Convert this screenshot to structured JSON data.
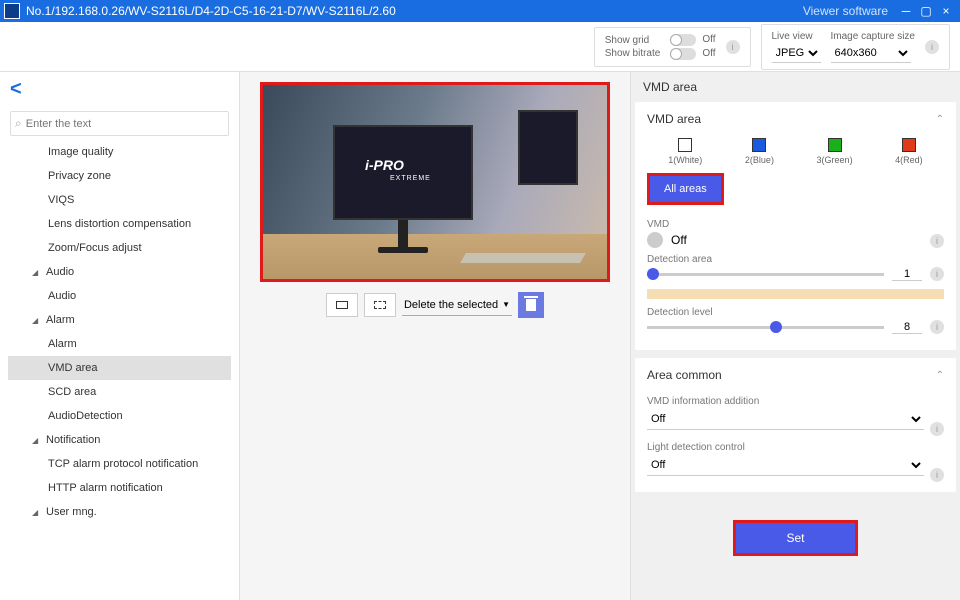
{
  "titlebar": {
    "title": "No.1/192.168.0.26/WV-S2116L/D4-2D-C5-16-21-D7/WV-S2116L/2.60",
    "brand": "Viewer software"
  },
  "topbar": {
    "show_grid_label": "Show grid",
    "show_grid_value": "Off",
    "show_bitrate_label": "Show bitrate",
    "show_bitrate_value": "Off",
    "live_view_label": "Live view",
    "live_view_value": "JPEG",
    "capture_label": "Image capture size",
    "capture_value": "640x360"
  },
  "search": {
    "placeholder": "Enter the text"
  },
  "tree": {
    "items": [
      {
        "label": "Image quality",
        "type": "item"
      },
      {
        "label": "Privacy zone",
        "type": "item"
      },
      {
        "label": "VIQS",
        "type": "item"
      },
      {
        "label": "Lens distortion compensation",
        "type": "item"
      },
      {
        "label": "Zoom/Focus adjust",
        "type": "item"
      },
      {
        "label": "Audio",
        "type": "group"
      },
      {
        "label": "Audio",
        "type": "item"
      },
      {
        "label": "Alarm",
        "type": "group"
      },
      {
        "label": "Alarm",
        "type": "item"
      },
      {
        "label": "VMD area",
        "type": "item",
        "selected": true
      },
      {
        "label": "SCD area",
        "type": "item"
      },
      {
        "label": "AudioDetection",
        "type": "item"
      },
      {
        "label": "Notification",
        "type": "group"
      },
      {
        "label": "TCP alarm protocol notification",
        "type": "item"
      },
      {
        "label": "HTTP alarm notification",
        "type": "item"
      },
      {
        "label": "User mng.",
        "type": "group"
      }
    ]
  },
  "video": {
    "logo": "i-PRO",
    "logo_sub": "EXTREME"
  },
  "video_toolbar": {
    "delete_label": "Delete the selected"
  },
  "right": {
    "header": "VMD area",
    "vmd_title": "VMD area",
    "areas": [
      {
        "label": "1(White)",
        "color": "white"
      },
      {
        "label": "2(Blue)",
        "color": "blue"
      },
      {
        "label": "3(Green)",
        "color": "green"
      },
      {
        "label": "4(Red)",
        "color": "red"
      }
    ],
    "all_areas": "All areas",
    "vmd_label": "VMD",
    "vmd_value": "Off",
    "detection_area_label": "Detection area",
    "detection_area_value": "1",
    "detection_level_label": "Detection level",
    "detection_level_value": "8",
    "area_common_title": "Area common",
    "info_addition_label": "VMD information addition",
    "info_addition_value": "Off",
    "light_detection_label": "Light detection control",
    "light_detection_value": "Off",
    "set_label": "Set"
  }
}
